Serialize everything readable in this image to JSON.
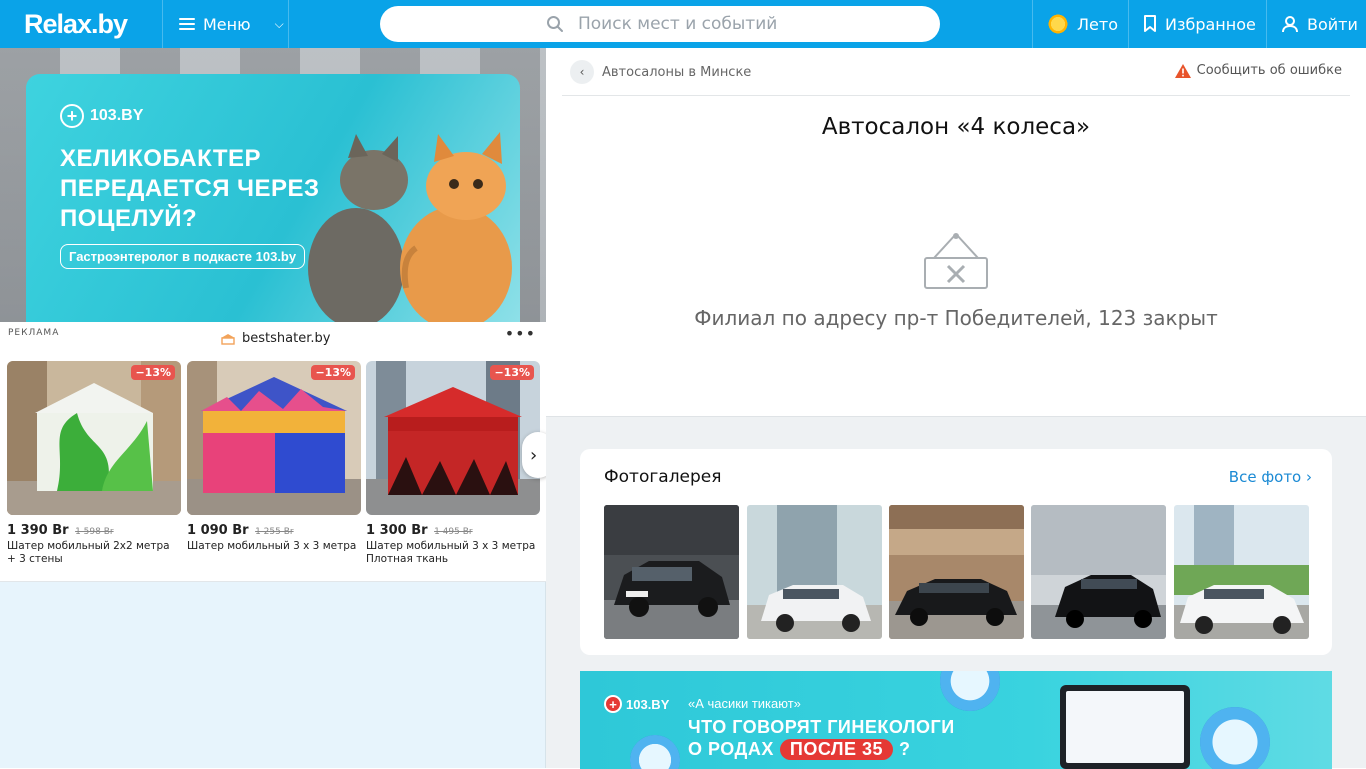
{
  "header": {
    "logo": "Relax.by",
    "menu_label": "Меню",
    "search_placeholder": "Поиск мест и событий",
    "season_label": "Лето",
    "favorites_label": "Избранное",
    "login_label": "Войти",
    "colors": {
      "bar": "#0aa3e8",
      "text": "#ffffff"
    }
  },
  "left_ad": {
    "brand": "103.BY",
    "headline": "ХЕЛИКОБАКТЕР ПЕРЕДАЕТСЯ ЧЕРЕЗ ПОЦЕЛУЙ?",
    "pill": "Гастроэнтеролог в подкасте 103.by"
  },
  "promo": {
    "ad_label": "РЕКЛАМА",
    "brand": "bestshater.by",
    "more": "•••",
    "products": [
      {
        "discount": "−13%",
        "price": "1 390 Br",
        "old_price": "1 598 Br",
        "name": "Шатер мобильный 2х2 метра + 3 стены"
      },
      {
        "discount": "−13%",
        "price": "1 090 Br",
        "old_price": "1 255 Br",
        "name": "Шатер мобильный 3 х 3 метра"
      },
      {
        "discount": "−13%",
        "price": "1 300 Br",
        "old_price": "1 495 Br",
        "name": "Шатер мобильный 3 х 3 метра Плотная ткань"
      }
    ]
  },
  "main": {
    "breadcrumb": "Автосалоны в Минске",
    "report_label": "Сообщить об ошибке",
    "title": "Автосалон «4 колеса»",
    "closed_text": "Филиал по адресу пр-т Победителей, 123 закрыт",
    "gallery": {
      "title": "Фотогалерея",
      "all_photos": "Все фото ›",
      "photos": [
        "lexus-nx",
        "bmw-x5-white",
        "audi-a6-black",
        "bmw-5-black",
        "bmw-x5-white-2"
      ]
    },
    "bottom_ad": {
      "brand": "103.BY",
      "quote": "«А часики тикают»",
      "line1": "ЧТО ГОВОРЯТ ГИНЕКОЛОГИ",
      "line2_prefix": "О РОДАХ",
      "line2_pill": "ПОСЛЕ 35",
      "line2_suffix": "?"
    }
  }
}
